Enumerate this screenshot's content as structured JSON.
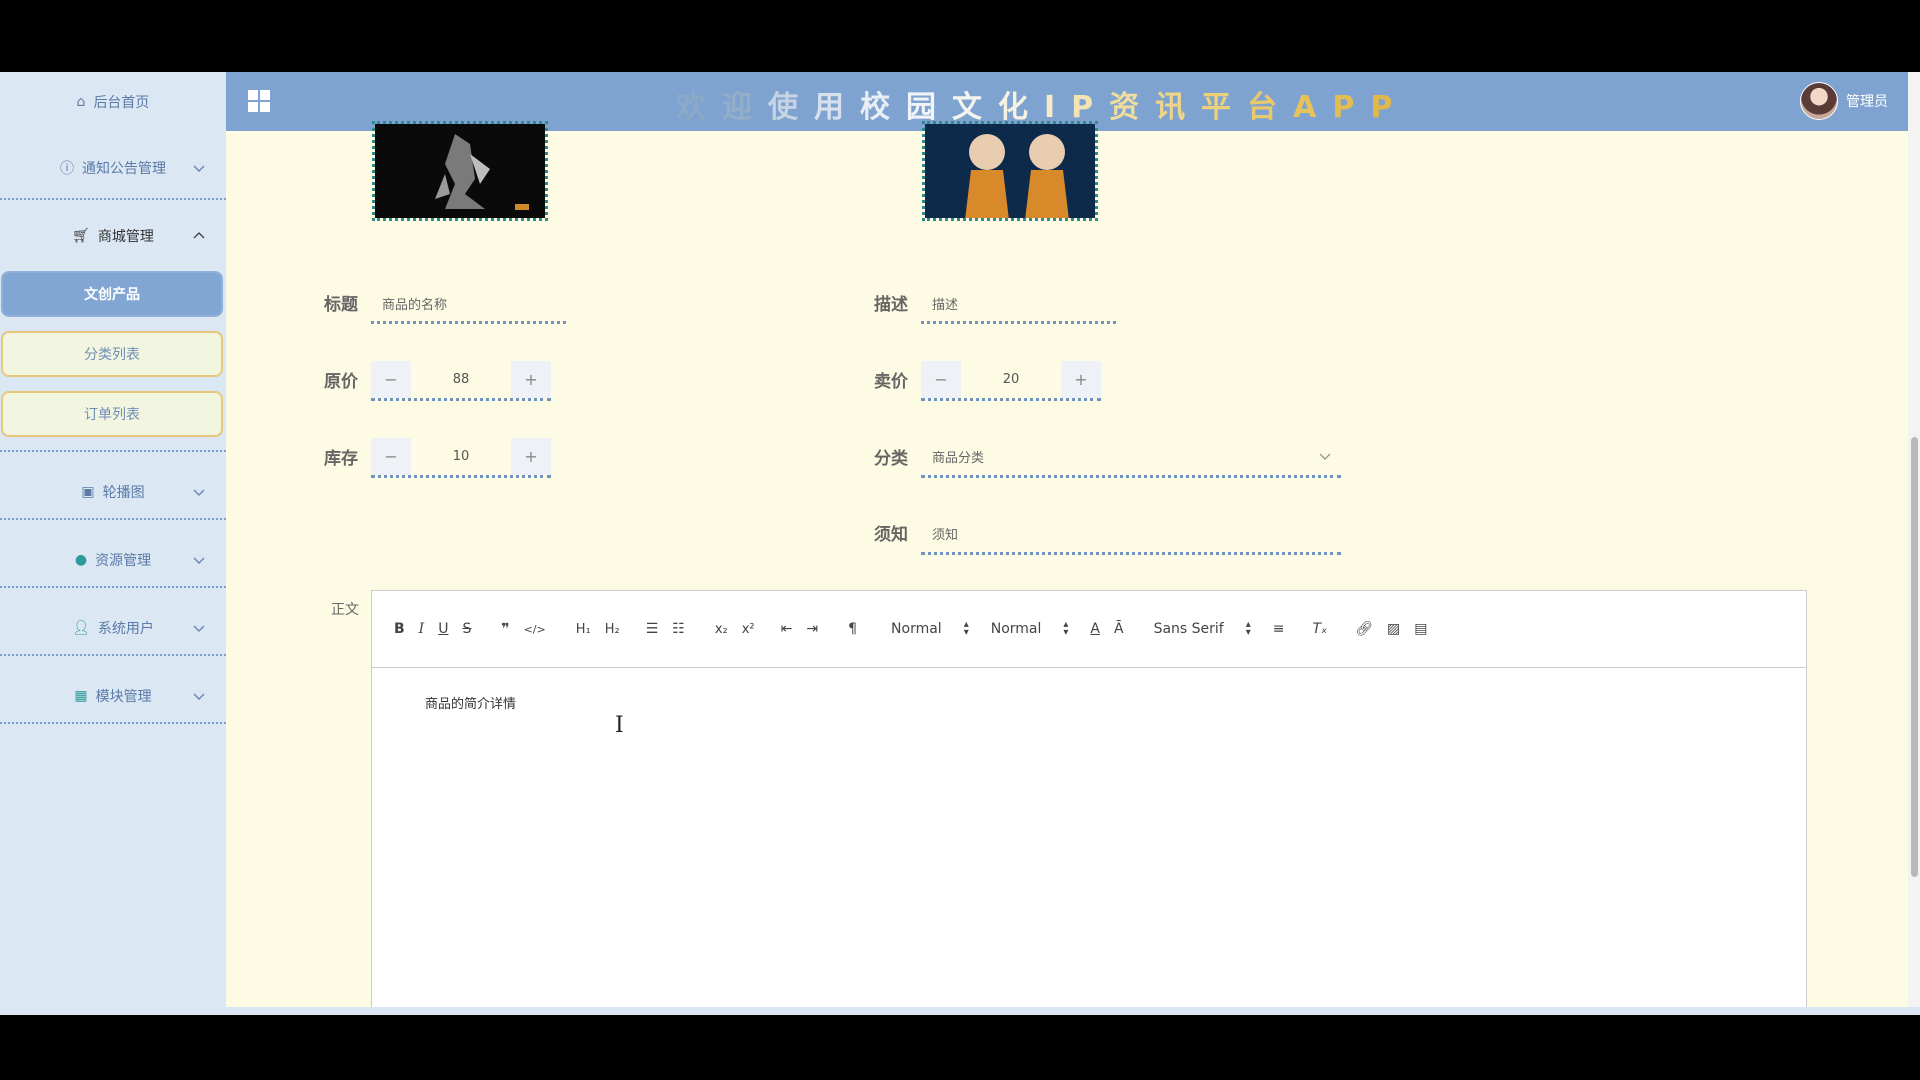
{
  "sidebar": {
    "home": "后台首页",
    "items": [
      {
        "label": "通知公告管理",
        "icon": "info-icon"
      },
      {
        "label": "商城管理",
        "icon": "cart-icon"
      },
      {
        "label": "轮播图",
        "icon": "image-icon"
      },
      {
        "label": "资源管理",
        "icon": "balloon-icon"
      },
      {
        "label": "系统用户",
        "icon": "user-icon"
      },
      {
        "label": "模块管理",
        "icon": "grid-icon"
      }
    ],
    "subitems": [
      "文创产品",
      "分类列表",
      "订单列表"
    ]
  },
  "header": {
    "title_chars": [
      "欢",
      "迎",
      "使",
      "用",
      "校",
      "园",
      "文",
      "化",
      "I",
      "P",
      "资",
      "讯",
      "平",
      "台",
      "A",
      "P",
      "P"
    ],
    "title_colors": [
      "#8ea9c8",
      "#95aec8",
      "#c6d3e3",
      "#d7e1ec",
      "#e9eef5",
      "#f0f3f8",
      "#f5f5f0",
      "#f6f1e1",
      "#f5ebc7",
      "#f2e4b3",
      "#f0dc9c",
      "#eed589",
      "#ecd07b",
      "#e9c96a",
      "#e6c25c",
      "#e4bd52",
      "#e2b84a"
    ],
    "user": "管理员"
  },
  "form": {
    "title_label": "标题",
    "title_placeholder": "商品的名称",
    "desc_label": "描述",
    "desc_placeholder": "描述",
    "price_label": "原价",
    "price_value": "88",
    "sale_label": "卖价",
    "sale_value": "20",
    "stock_label": "库存",
    "stock_value": "10",
    "category_label": "分类",
    "category_placeholder": "商品分类",
    "notice_label": "须知",
    "notice_placeholder": "须知",
    "body_label": "正文",
    "body_text": "商品的简介详情"
  },
  "editor": {
    "heading_select": "Normal",
    "size_select": "Normal",
    "font_select": "Sans Serif"
  },
  "colors": {
    "accent": "#7ea3d0",
    "content_bg": "#fdfbe3",
    "sidebar_bg": "#dbe7f3"
  }
}
